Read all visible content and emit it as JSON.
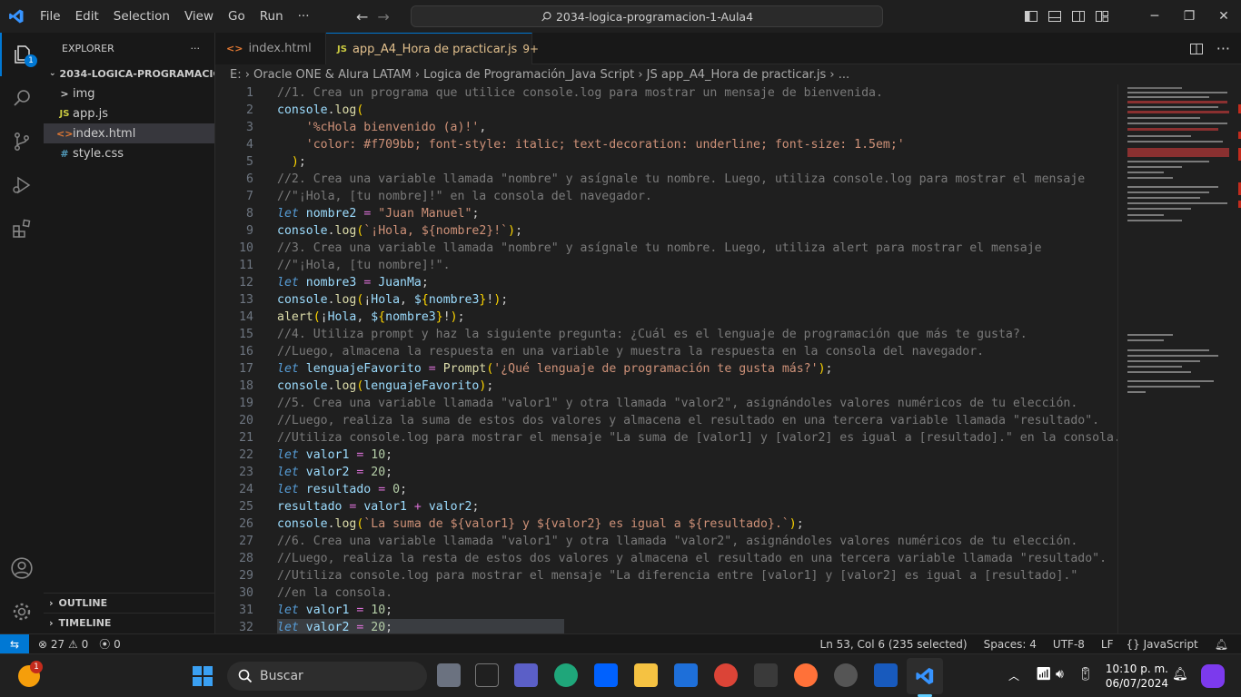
{
  "title_bar": {
    "menu": [
      "File",
      "Edit",
      "Selection",
      "View",
      "Go",
      "Run",
      "···"
    ],
    "command_center": "2034-logica-programacion-1-Aula4"
  },
  "activity_bar": {
    "explorer_badge": "1"
  },
  "sidebar": {
    "header": "EXPLORER",
    "more": "···",
    "folder": "2034-LOGICA-PROGRAMACIO...",
    "items": [
      {
        "label": "img",
        "icon": ">",
        "type": "folder"
      },
      {
        "label": "app.js",
        "icon": "JS",
        "type": "js"
      },
      {
        "label": "index.html",
        "icon": "<>",
        "type": "html"
      },
      {
        "label": "style.css",
        "icon": "#",
        "type": "css"
      }
    ],
    "outline": "OUTLINE",
    "timeline": "TIMELINE"
  },
  "tabs": [
    {
      "label": "index.html",
      "icon": "<>"
    },
    {
      "label": "app_A4_Hora de practicar.js",
      "icon": "JS",
      "badge": "9+"
    }
  ],
  "breadcrumb": "E: › Oracle ONE & Alura LATAM › Logica de Programación_Java Script › JS app_A4_Hora de practicar.js › ...",
  "editor": {
    "lines": [
      {
        "n": "1",
        "c": "//1. Crea un programa que utilice console.log para mostrar un mensaje de bienvenida."
      },
      {
        "n": "2",
        "c": "console.log("
      },
      {
        "n": "3",
        "c": "    '%cHola bienvenido (a)!',"
      },
      {
        "n": "4",
        "c": "    'color: #f709bb; font-style: italic; text-decoration: underline; font-size: 1.5em;'"
      },
      {
        "n": "5",
        "c": "  );"
      },
      {
        "n": "6",
        "c": "//2. Crea una variable llamada \"nombre\" y asígnale tu nombre. Luego, utiliza console.log para mostrar el mensaje"
      },
      {
        "n": "7",
        "c": "//\"¡Hola, [tu nombre]!\" en la consola del navegador."
      },
      {
        "n": "8",
        "c": "let nombre2 = \"Juan Manuel\";"
      },
      {
        "n": "9",
        "c": "console.log(`¡Hola, ${nombre2}!`);"
      },
      {
        "n": "10",
        "c": "//3. Crea una variable llamada \"nombre\" y asígnale tu nombre. Luego, utiliza alert para mostrar el mensaje"
      },
      {
        "n": "11",
        "c": "//\"¡Hola, [tu nombre]!\"."
      },
      {
        "n": "12",
        "c": "let nombre3 = JuanMa;"
      },
      {
        "n": "13",
        "c": "console.log(¡Hola, ${nombre3}!);"
      },
      {
        "n": "14",
        "c": "alert(¡Hola, ${nombre3}!);"
      },
      {
        "n": "15",
        "c": "//4. Utiliza prompt y haz la siguiente pregunta: ¿Cuál es el lenguaje de programación que más te gusta?."
      },
      {
        "n": "16",
        "c": "//Luego, almacena la respuesta en una variable y muestra la respuesta en la consola del navegador."
      },
      {
        "n": "17",
        "c": "let lenguajeFavorito = Prompt('¿Qué lenguaje de programación te gusta más?');"
      },
      {
        "n": "18",
        "c": "console.log(lenguajeFavorito);"
      },
      {
        "n": "19",
        "c": "//5. Crea una variable llamada \"valor1\" y otra llamada \"valor2\", asignándoles valores numéricos de tu elección."
      },
      {
        "n": "20",
        "c": "//Luego, realiza la suma de estos dos valores y almacena el resultado en una tercera variable llamada \"resultado\"."
      },
      {
        "n": "21",
        "c": "//Utiliza console.log para mostrar el mensaje \"La suma de [valor1] y [valor2] es igual a [resultado].\" en la consola."
      },
      {
        "n": "22",
        "c": "let valor1 = 10;"
      },
      {
        "n": "23",
        "c": "let valor2 = 20;"
      },
      {
        "n": "24",
        "c": "let resultado = 0;"
      },
      {
        "n": "25",
        "c": "resultado = valor1 + valor2;"
      },
      {
        "n": "26",
        "c": "console.log(`La suma de ${valor1} y ${valor2} es igual a ${resultado}.`);"
      },
      {
        "n": "27",
        "c": "//6. Crea una variable llamada \"valor1\" y otra llamada \"valor2\", asignándoles valores numéricos de tu elección."
      },
      {
        "n": "28",
        "c": "//Luego, realiza la resta de estos dos valores y almacena el resultado en una tercera variable llamada \"resultado\"."
      },
      {
        "n": "29",
        "c": "//Utiliza console.log para mostrar el mensaje \"La diferencia entre [valor1] y [valor2] es igual a [resultado].\""
      },
      {
        "n": "30",
        "c": "//en la consola."
      },
      {
        "n": "31",
        "c": "let valor1 = 10;"
      },
      {
        "n": "32",
        "c": "let valor2 = 20;"
      }
    ]
  },
  "status_bar": {
    "errors": "27",
    "warnings": "0",
    "ports": "0",
    "position": "Ln 53, Col 6 (235 selected)",
    "spaces": "Spaces: 4",
    "encoding": "UTF-8",
    "eol": "LF",
    "language": "JavaScript"
  },
  "taskbar": {
    "search_placeholder": "Buscar",
    "time": "10:10 p. m.",
    "date": "06/07/2024",
    "notification_badge": "1"
  }
}
